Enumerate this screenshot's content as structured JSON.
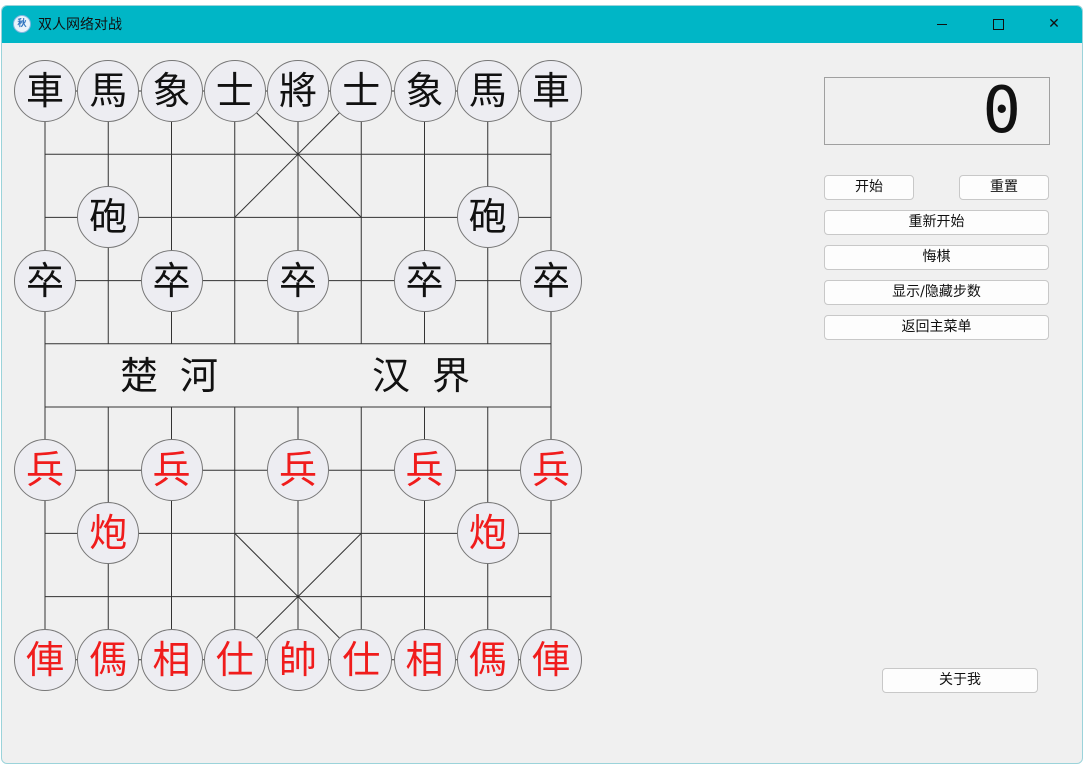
{
  "window": {
    "title": "双人网络对战",
    "app_icon_text": "秋"
  },
  "board": {
    "river_left": "楚河",
    "river_right": "汉界",
    "black_back": [
      "車",
      "馬",
      "象",
      "士",
      "將",
      "士",
      "象",
      "馬",
      "車"
    ],
    "black_cannon": "砲",
    "black_soldier": "卒",
    "red_back": [
      "俥",
      "傌",
      "相",
      "仕",
      "帥",
      "仕",
      "相",
      "傌",
      "俥"
    ],
    "red_cannon": "炮",
    "red_soldier": "兵",
    "colors": {
      "red": "#f01c1c",
      "black": "#111111",
      "line": "#333333"
    }
  },
  "side_panel": {
    "move_count": "0",
    "buttons": {
      "start": "开始",
      "reset": "重置",
      "restart": "重新开始",
      "undo": "悔棋",
      "toggle_steps": "显示/隐藏步数",
      "back_to_menu": "返回主菜单",
      "about": "关于我"
    }
  }
}
